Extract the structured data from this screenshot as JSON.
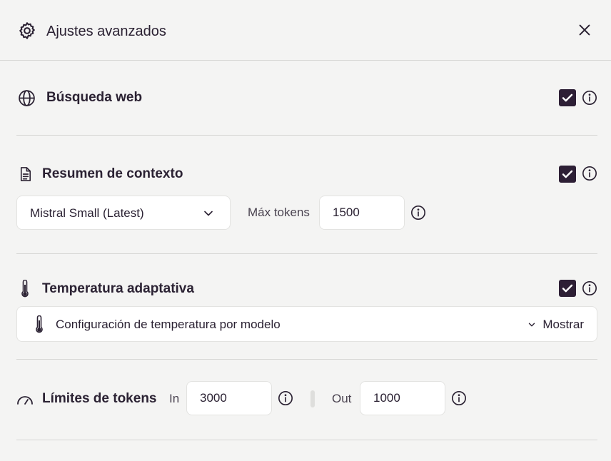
{
  "dialog": {
    "title": "Ajustes avanzados",
    "icons": {
      "title": "gear-icon",
      "close": "close-icon"
    }
  },
  "web_search": {
    "title": "Búsqueda web",
    "icon": "globe-icon",
    "checked": true
  },
  "context_summary": {
    "title": "Resumen de contexto",
    "icon": "document-icon",
    "checked": true,
    "model_select": {
      "value": "Mistral Small (Latest)"
    },
    "max_tokens_label": "Máx tokens",
    "max_tokens_value": "1500"
  },
  "adaptive_temperature": {
    "title": "Temperatura adaptativa",
    "icon": "thermometer-icon",
    "checked": true,
    "per_model_label": "Configuración de temperatura por modelo",
    "show_label": "Mostrar"
  },
  "token_limits": {
    "title": "Límites de tokens",
    "icon": "gauge-icon",
    "in_label": "In",
    "in_value": "3000",
    "out_label": "Out",
    "out_value": "1000"
  },
  "colors": {
    "background": "#f4f4f3",
    "checkbox": "#2d1f35",
    "text": "#2b2233",
    "divider": "#d6d6d4"
  }
}
